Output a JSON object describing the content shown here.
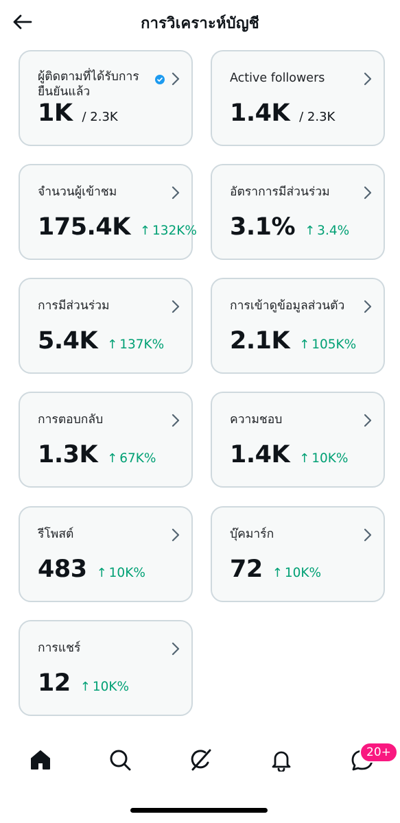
{
  "header": {
    "title": "การวิเคราะห์บัญชี"
  },
  "cards": [
    {
      "title": "ผู้ติดตามที่ได้รับการยืนยันแล้ว",
      "value": "1K",
      "sub": "/ 2.3K",
      "verified": true
    },
    {
      "title": "Active followers",
      "value": "1.4K",
      "sub": "/ 2.3K"
    },
    {
      "title": "จำนวนผู้เข้าชม",
      "value": "175.4K",
      "delta": "132K%"
    },
    {
      "title": "อัตราการมีส่วนร่วม",
      "value": "3.1%",
      "delta": "3.4%"
    },
    {
      "title": "การมีส่วนร่วม",
      "value": "5.4K",
      "delta": "137K%"
    },
    {
      "title": "การเข้าดูข้อมูลส่วนตัว",
      "value": "2.1K",
      "delta": "105K%"
    },
    {
      "title": "การตอบกลับ",
      "value": "1.3K",
      "delta": "67K%"
    },
    {
      "title": "ความชอบ",
      "value": "1.4K",
      "delta": "10K%"
    },
    {
      "title": "รีโพสต์",
      "value": "483",
      "delta": "10K%"
    },
    {
      "title": "บุ๊คมาร์ก",
      "value": "72",
      "delta": "10K%"
    },
    {
      "title": "การแชร์",
      "value": "12",
      "delta": "10K%"
    }
  ],
  "delta_arrow": "↑",
  "colors": {
    "positive": "#00a074",
    "badge": "#f91880",
    "card_bg": "#f7f9f9",
    "card_border": "#cfd9de",
    "verified": "#1d9bf0"
  },
  "nav": {
    "items": [
      {
        "icon": "home-icon"
      },
      {
        "icon": "search-icon"
      },
      {
        "icon": "grok-icon"
      },
      {
        "icon": "bell-icon"
      },
      {
        "icon": "messages-icon"
      }
    ],
    "messages_badge": "20+"
  }
}
